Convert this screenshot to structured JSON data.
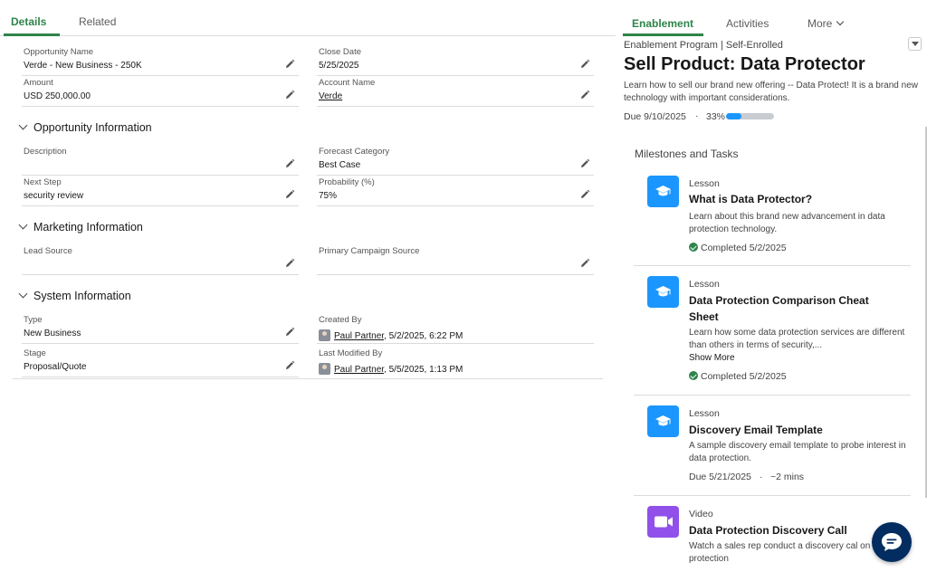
{
  "left_tabs": [
    {
      "label": "Details",
      "active": true
    },
    {
      "label": "Related",
      "active": false
    }
  ],
  "fields": {
    "opportunity_name": {
      "label": "Opportunity Name",
      "value": "Verde - New Business - 250K"
    },
    "close_date": {
      "label": "Close Date",
      "value": "5/25/2025"
    },
    "amount": {
      "label": "Amount",
      "value": "USD 250,000.00"
    },
    "account_name": {
      "label": "Account Name",
      "value": "Verde"
    },
    "description": {
      "label": "Description",
      "value": ""
    },
    "forecast_category": {
      "label": "Forecast Category",
      "value": "Best Case"
    },
    "next_step": {
      "label": "Next Step",
      "value": "security review"
    },
    "probability": {
      "label": "Probability (%)",
      "value": "75%"
    },
    "lead_source": {
      "label": "Lead Source",
      "value": ""
    },
    "primary_campaign_source": {
      "label": "Primary Campaign Source",
      "value": ""
    },
    "type": {
      "label": "Type",
      "value": "New Business"
    },
    "created_by": {
      "label": "Created By",
      "user": "Paul Partner",
      "date": ", 5/2/2025, 6:22 PM"
    },
    "stage": {
      "label": "Stage",
      "value": "Proposal/Quote"
    },
    "last_modified_by": {
      "label": "Last Modified By",
      "user": "Paul Partner",
      "date": ", 5/5/2025, 1:13 PM"
    }
  },
  "sections": {
    "opportunity_info": "Opportunity Information",
    "marketing_info": "Marketing Information",
    "system_info": "System Information"
  },
  "right_tabs": {
    "enablement": "Enablement",
    "activities": "Activities",
    "more": "More"
  },
  "program": {
    "eyebrow": "Enablement Program | Self-Enrolled",
    "title": "Sell Product: Data Protector",
    "description": "Learn how to sell our brand new offering -- Data Protect! It is a brand new technology with important considerations.",
    "due": "Due 9/10/2025",
    "separator": "·",
    "progress_label": "33%",
    "progress_value": 0.33
  },
  "milestones": {
    "heading": "Milestones and Tasks",
    "items": [
      {
        "type": "Lesson",
        "title": "What is Data Protector?",
        "description": "Learn about this brand new advancement in data protection technology.",
        "status": "Completed 5/2/2025"
      },
      {
        "type": "Lesson",
        "title": "Data Protection Comparison Cheat Sheet",
        "description": "Learn how some data protection services are different than others in terms of security,...",
        "show_more": "Show More",
        "status": "Completed 5/2/2025"
      },
      {
        "type": "Lesson",
        "title": "Discovery Email Template",
        "description": "A sample discovery email template to probe interest in data protection.",
        "due": "Due 5/21/2025",
        "separator": "·",
        "duration": "~2 mins"
      },
      {
        "type": "Video",
        "title": "Data Protection Discovery Call",
        "description": "Watch a sales rep conduct a discovery cal on data protection"
      }
    ]
  },
  "colors": {
    "accent_green": "#2e844a",
    "lesson_blue": "#1b96ff",
    "video_purple": "#9050e9",
    "chat_navy": "#032d60"
  },
  "icons": [
    "edit-pencil-icon",
    "chevron-down-icon",
    "lesson-cap-icon",
    "video-camera-icon",
    "check-circle-icon",
    "chat-bubble-icon",
    "avatar"
  ]
}
